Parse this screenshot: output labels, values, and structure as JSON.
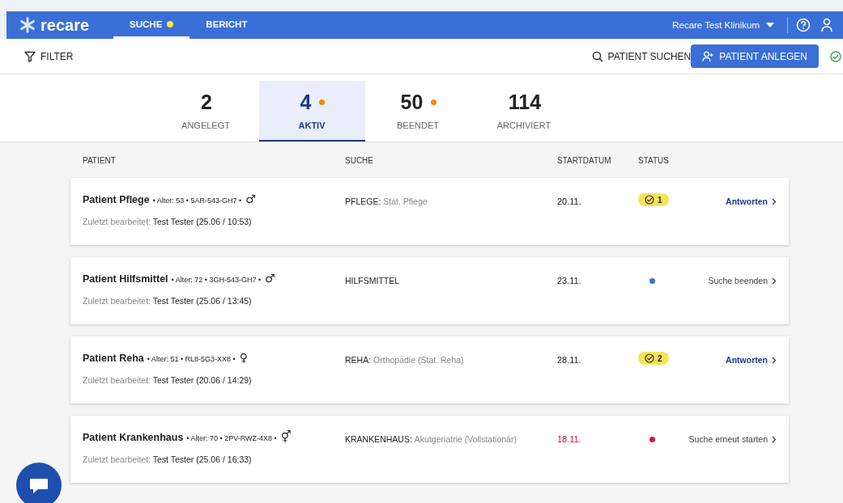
{
  "navbar": {
    "logo": "recare",
    "tabs": [
      {
        "label": "SUCHE",
        "selected": true,
        "dot": true
      },
      {
        "label": "BERICHT",
        "selected": false,
        "dot": false
      }
    ],
    "account": "Recare Test Klinikum"
  },
  "toolbar": {
    "filter": "FILTER",
    "search": "PATIENT SUCHEN",
    "create": "PATIENT ANLEGEN"
  },
  "counters": [
    {
      "count": "2",
      "label": "ANGELEGT",
      "selected": false,
      "dot": false
    },
    {
      "count": "4",
      "label": "AKTIV",
      "selected": true,
      "dot": true
    },
    {
      "count": "50",
      "label": "BEENDET",
      "selected": false,
      "dot": true
    },
    {
      "count": "114",
      "label": "ARCHIVIERT",
      "selected": false,
      "dot": false
    }
  ],
  "table": {
    "columns": [
      "PATIENT",
      "SUCHE",
      "STARTDATUM",
      "STATUS"
    ],
    "rows": [
      {
        "name": "Patient Pflege",
        "meta": "• Alter: 53 • 5AR-543-GH7 •",
        "gender": "♂",
        "search_type": "PFLEGE:",
        "search_detail": "Stat. Pflege",
        "edited_label": "Zuletzt bearbeitet:",
        "edited_by": "Test Tester (25.06 / 10:53)",
        "date": "20.11.",
        "overdue": false,
        "status": {
          "kind": "badge",
          "count": "1"
        },
        "action": "Antworten",
        "action_primary": true
      },
      {
        "name": "Patient Hilfsmittel",
        "meta": "• Alter: 72 • 3GH-543-GH7 •",
        "gender": "♂",
        "search_type": "HILFSMITTEL",
        "edited_label": "Zuletzt bearbeitet:",
        "edited_by": "Test Tester (25.06 / 13:45)",
        "date": "23.11.",
        "overdue": false,
        "status": {
          "kind": "dot",
          "color": "#3b6fd8"
        },
        "action": "Suche beenden",
        "action_primary": false
      },
      {
        "name": "Patient Reha",
        "meta": "• Alter: 51 • RL8-5G3-XX8 •",
        "gender": "♀",
        "search_type": "REHA:",
        "search_detail": "Orthopädie (Stat. Reha)",
        "edited_label": "Zuletzt bearbeitet:",
        "edited_by": "Test Tester (20.06 / 14:29)",
        "date": "28.11.",
        "overdue": false,
        "status": {
          "kind": "badge",
          "count": "2"
        },
        "action": "Antworten",
        "action_primary": true
      },
      {
        "name": "Patient Krankenhaus",
        "meta": "• Alter: 70 • 2PV-RWZ-4X8 •",
        "gender": "⚥",
        "search_type": "KRANKENHAUS:",
        "search_detail": "Akutgeriatrie (Vollstationär)",
        "edited_label": "Zuletzt bearbeitet:",
        "edited_by": "Test Tester (25.06 / 16:33)",
        "date": "18.11.",
        "overdue": true,
        "status": {
          "kind": "dot",
          "color": "#e0103f"
        },
        "action": "Suche erneut starten",
        "action_primary": false
      }
    ]
  }
}
